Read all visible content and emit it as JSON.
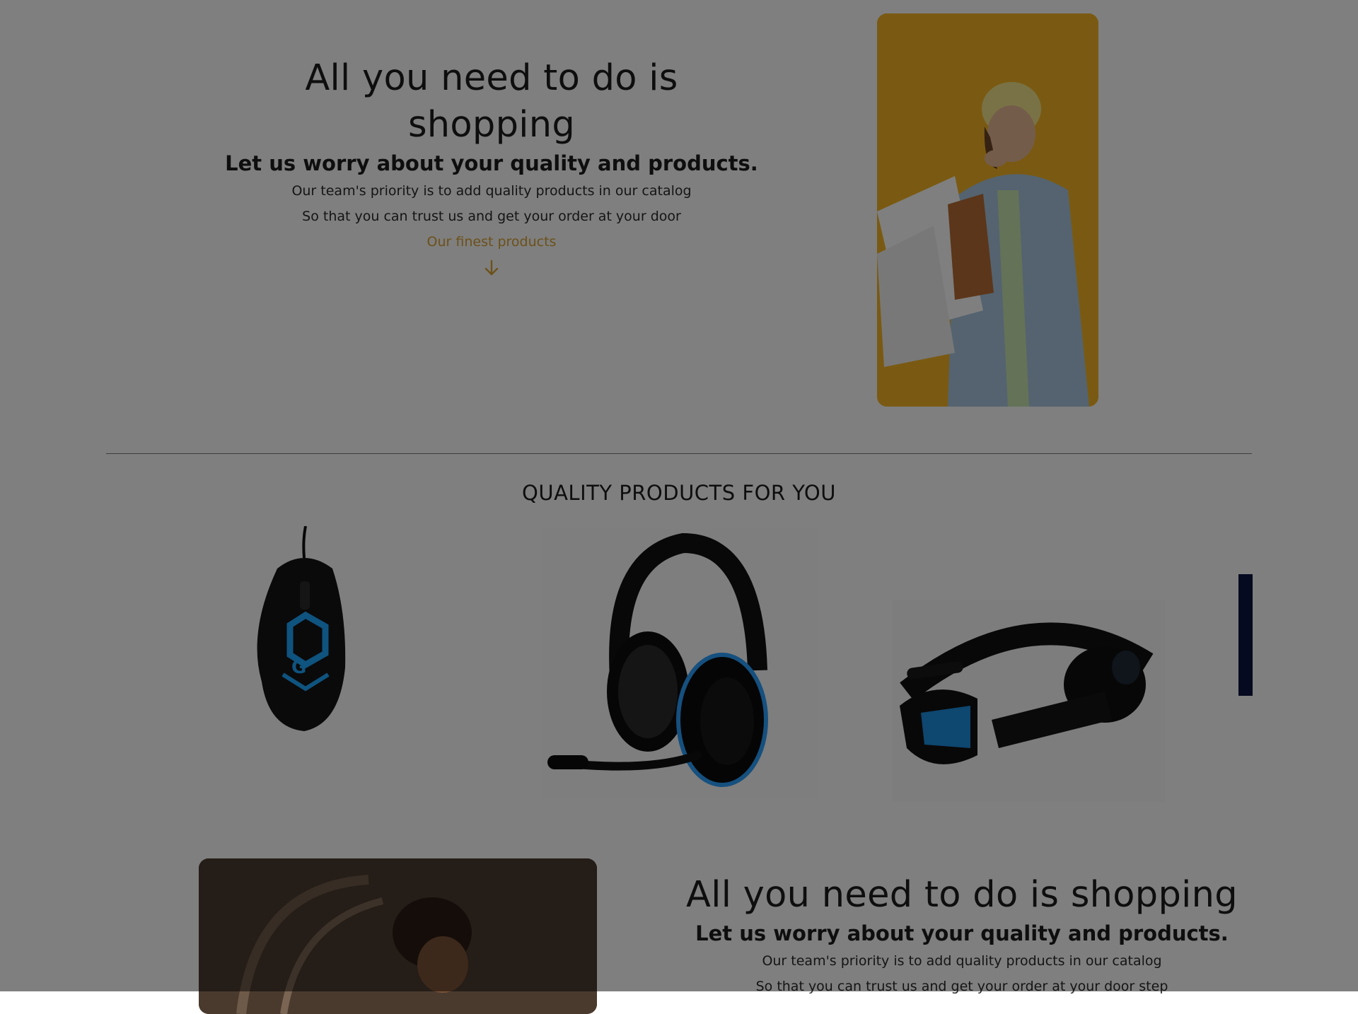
{
  "hero_top": {
    "heading": "All you need to do is shopping",
    "subheading": "Let us worry about your quality and products.",
    "line1": "Our team's priority is to add quality products in our catalog",
    "line2": "So that you can trust us and get your order at your door",
    "link": "Our finest products"
  },
  "section": {
    "title": "QUALITY PRODUCTS FOR YOU"
  },
  "hero_bottom": {
    "heading": "All you need to do is shopping",
    "subheading": "Let us worry about your quality and products.",
    "line1": "Our team's priority is to add quality products in our catalog",
    "line2": "So that you can trust us and get your order at your door step"
  },
  "colors": {
    "accent": "#d9a233",
    "overlay": "rgba(0,0,0,0.5)"
  }
}
